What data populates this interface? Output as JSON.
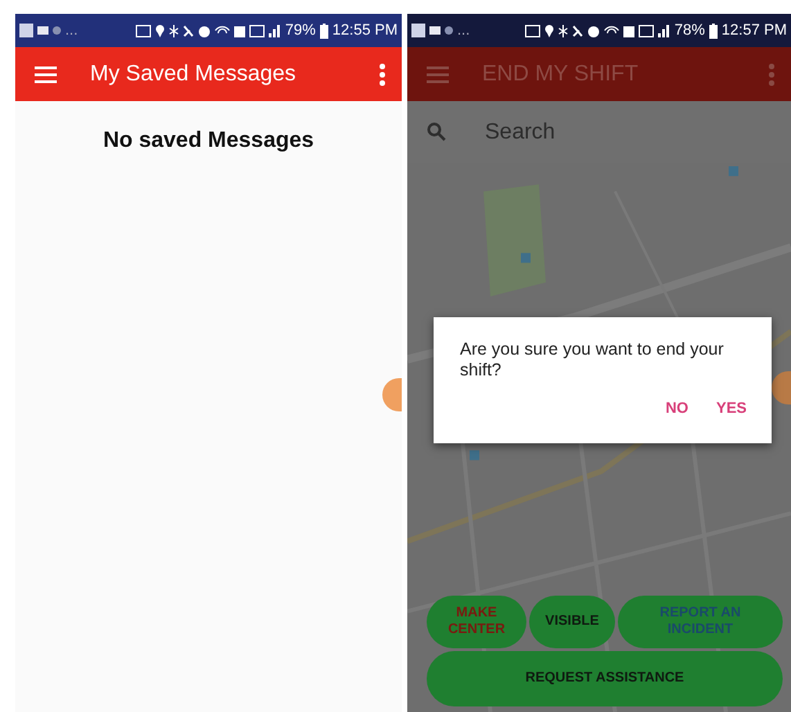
{
  "saved_messages_screen": {
    "status_bar": {
      "overflow": "...",
      "battery": "79%",
      "time": "12:55 PM"
    },
    "app_bar": {
      "title": "My Saved Messages"
    },
    "empty_message": "No saved Messages"
  },
  "end_shift_screen": {
    "status_bar": {
      "overflow": "...",
      "battery": "78%",
      "time": "12:57 PM"
    },
    "app_bar": {
      "title": "END MY SHIFT"
    },
    "search": {
      "placeholder": "Search"
    },
    "dialog": {
      "message": "Are you sure you want to end your shift?",
      "buttons": [
        "NO",
        "YES"
      ]
    },
    "action_buttons": [
      {
        "label": "MAKE CENTER",
        "kind": "alert"
      },
      {
        "label": "VISIBLE",
        "kind": "plain"
      },
      {
        "label": "REPORT AN INCIDENT",
        "kind": "info"
      },
      {
        "label": "REQUEST ASSISTANCE",
        "kind": "plain"
      }
    ]
  }
}
